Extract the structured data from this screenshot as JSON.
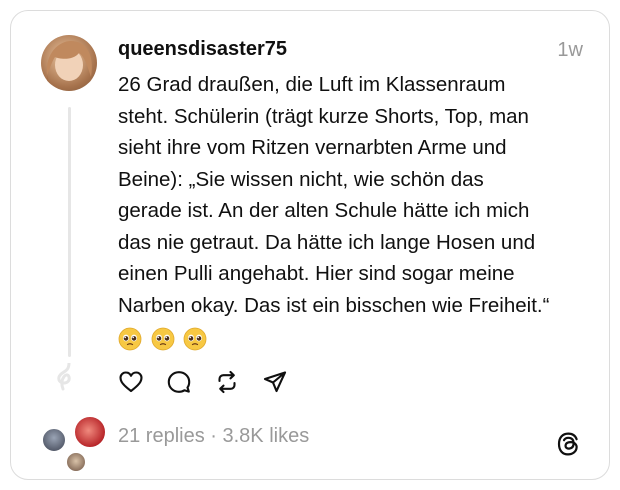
{
  "post": {
    "username": "queensdisaster75",
    "time": "1w",
    "text_lines": [
      "26 Grad draußen, die Luft im Klassenraum",
      "steht. Schülerin (trägt kurze Shorts, Top, man",
      "sieht ihre vom Ritzen vernarbten Arme und",
      "Beine): „Sie wissen nicht, wie schön das",
      "gerade ist. An der alten Schule hätte ich mich",
      "das nie getraut. Da hätte ich lange Hosen und",
      "einen Pulli angehabt. Hier sind sogar meine",
      "Narben okay. Das ist ein bisschen wie Freiheit.“"
    ],
    "emojis": [
      "pleading-face-emoji",
      "pleading-face-emoji",
      "pleading-face-emoji"
    ]
  },
  "actions": [
    {
      "icon": "heart-icon"
    },
    {
      "icon": "comment-icon"
    },
    {
      "icon": "repost-icon"
    },
    {
      "icon": "share-icon"
    }
  ],
  "stats": {
    "replies": "21 replies",
    "separator": " · ",
    "likes": "3.8K likes"
  },
  "colors": {
    "text": "#101010",
    "secondary": "#999999",
    "border": "#dcdcdc"
  }
}
